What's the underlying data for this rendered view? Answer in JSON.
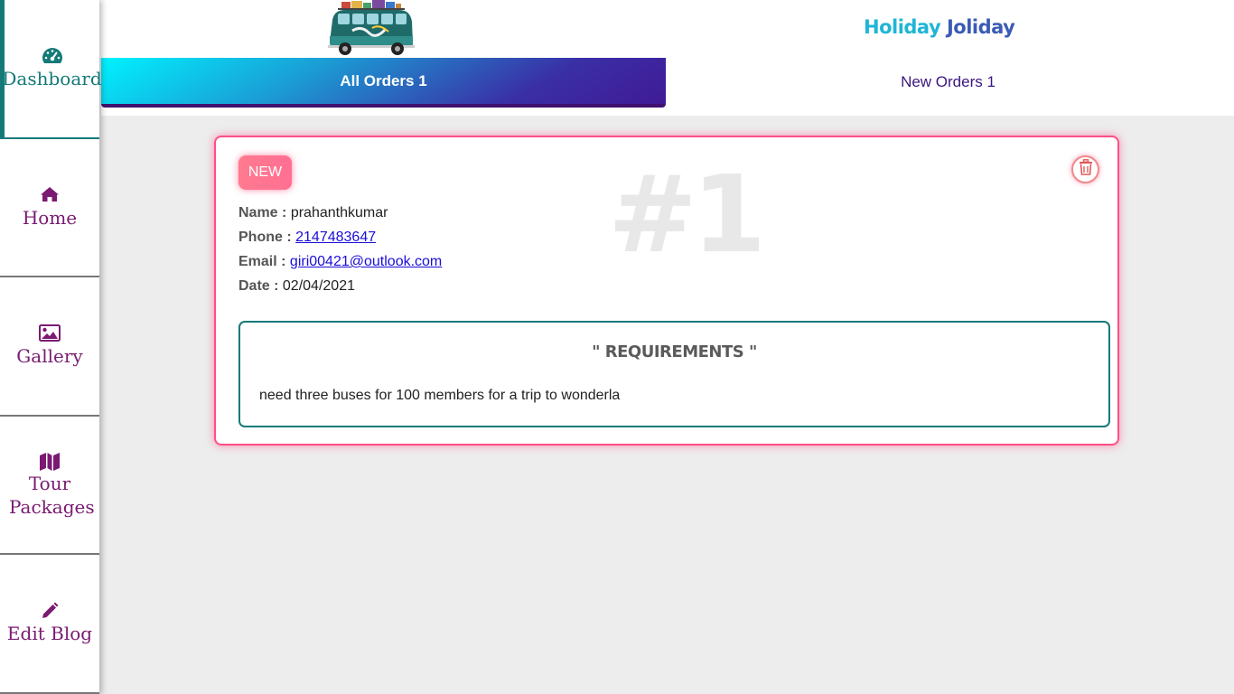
{
  "sidebar": {
    "items": [
      {
        "label": "Dashboard",
        "icon": "dashboard-gauge-icon"
      },
      {
        "label": "Home",
        "icon": "home-icon"
      },
      {
        "label": "Gallery",
        "icon": "image-icon"
      },
      {
        "label": "Tour Packages",
        "icon": "map-icon"
      },
      {
        "label": "Edit Blog",
        "icon": "pencil-icon"
      }
    ]
  },
  "header": {
    "brand_word1": "Holiday",
    "brand_word2": "Joliday",
    "logo_icon": "van-logo-icon"
  },
  "tabs": {
    "all_orders": "All Orders 1",
    "new_orders": "New Orders 1"
  },
  "order": {
    "badge": "NEW",
    "number": "#1",
    "name_label": "Name :",
    "name": "prahanthkumar",
    "phone_label": "Phone :",
    "phone": "2147483647",
    "email_label": "Email :",
    "email": "giri00421@outlook.com",
    "date_label": "Date :",
    "date": "02/04/2021",
    "requirements_title": "\" REQUIREMENTS \"",
    "requirements_text": "need three buses for 100 members for a trip to wonderla",
    "delete_icon": "trash-icon"
  },
  "colors": {
    "accent_teal": "#137a78",
    "accent_purple": "#7a1a72",
    "card_border": "#ff4f86",
    "brand_light": "#1fb5d6",
    "brand_dark": "#3a5bb5"
  }
}
